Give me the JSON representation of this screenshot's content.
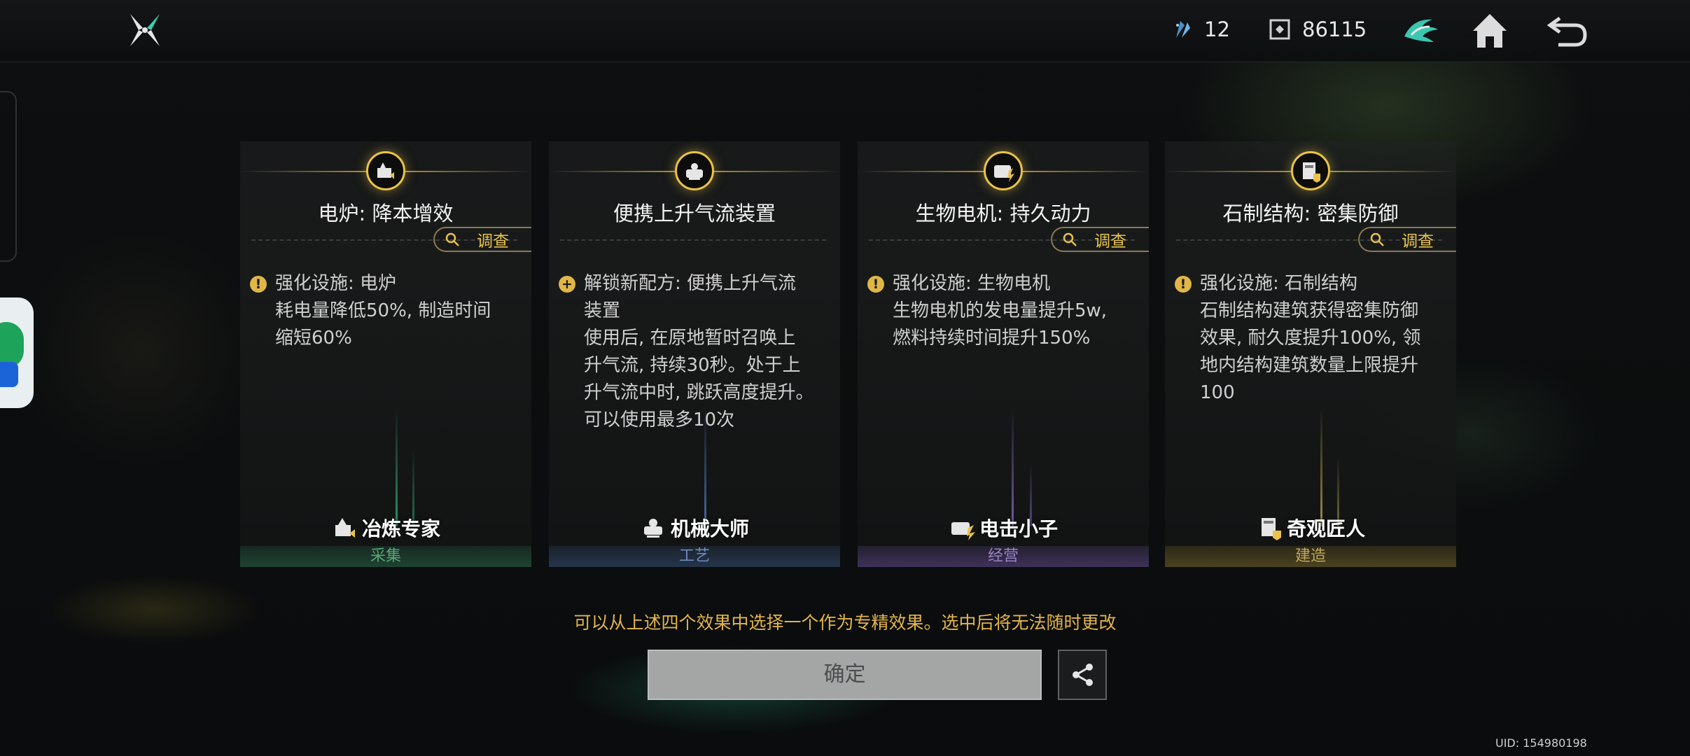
{
  "top_bar": {
    "resource_a_value": "12",
    "resource_b_value": "86115",
    "icons": [
      "game-logo-icon",
      "shard-currency-icon",
      "chip-currency-icon",
      "wing-crest-icon",
      "home-icon",
      "back-icon"
    ]
  },
  "cards": [
    {
      "title": "电炉: 降本增效",
      "investigate_label": "调查",
      "bullet_symbol": "!",
      "body": "强化设施: 电炉\n耗电量降低50%, 制造时间\n缩短60%",
      "role_name": "冶炼专家",
      "category": "采集",
      "accent_color": "#2e7d57"
    },
    {
      "title": "便携上升气流装置",
      "investigate_label": "",
      "bullet_symbol": "+",
      "body": "解锁新配方: 便携上升气流\n装置\n使用后, 在原地暂时召唤上\n升气流, 持续30秒。处于上\n升气流中时, 跳跃高度提升。\n可以使用最多10次",
      "role_name": "机械大师",
      "category": "工艺",
      "accent_color": "#3d5b8c"
    },
    {
      "title": "生物电机: 持久动力",
      "investigate_label": "调查",
      "bullet_symbol": "!",
      "body": "强化设施: 生物电机\n生物电机的发电量提升5w,\n燃料持续时间提升150%",
      "role_name": "电击小子",
      "category": "经营",
      "accent_color": "#6a4f9e"
    },
    {
      "title": "石制结构: 密集防御",
      "investigate_label": "调查",
      "bullet_symbol": "!",
      "body": "强化设施: 石制结构\n石制结构建筑获得密集防御\n效果, 耐久度提升100%, 领\n地内结构建筑数量上限提升\n100",
      "role_name": "奇观匠人",
      "category": "建造",
      "accent_color": "#8f7a2c"
    }
  ],
  "notice": "可以从上述四个效果中选择一个作为专精效果。选中后将无法随时更改",
  "confirm_label": "确定",
  "uid": "UID: 154980198",
  "colors": {
    "gold": "#e8c24a",
    "confirm_bg": "#a4a6a6"
  }
}
